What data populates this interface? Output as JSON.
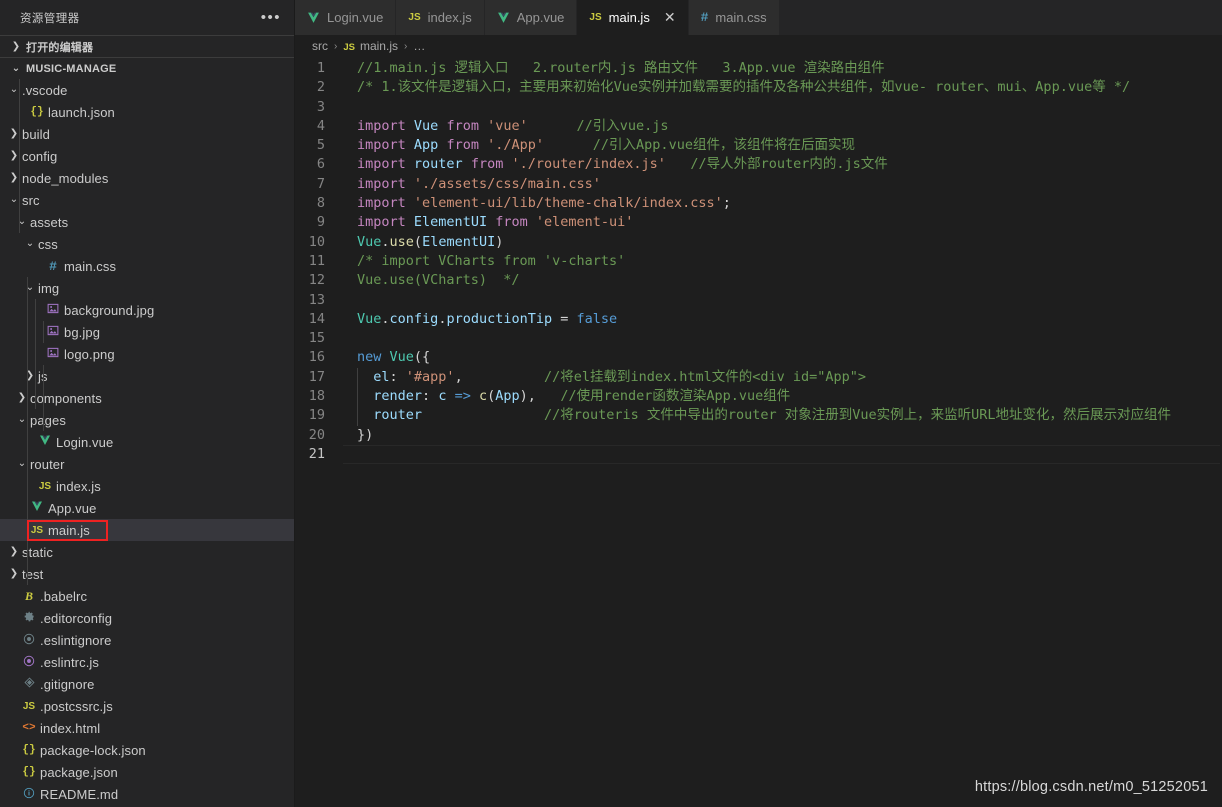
{
  "sidebar": {
    "title": "资源管理器",
    "more_icon": "ellipsis-icon",
    "open_editors_label": "打开的编辑器",
    "project_label": "MUSIC-MANAGE",
    "items": [
      {
        "label": ".vscode",
        "indent": 1,
        "twisty": "chevron-down",
        "icon": "",
        "icon_type": ""
      },
      {
        "label": "launch.json",
        "indent": 2,
        "twisty": "",
        "icon": "{}",
        "icon_type": "json"
      },
      {
        "label": "build",
        "indent": 1,
        "twisty": "chevron-right",
        "icon": "",
        "icon_type": ""
      },
      {
        "label": "config",
        "indent": 1,
        "twisty": "chevron-right",
        "icon": "",
        "icon_type": ""
      },
      {
        "label": "node_modules",
        "indent": 1,
        "twisty": "chevron-right",
        "icon": "",
        "icon_type": ""
      },
      {
        "label": "src",
        "indent": 1,
        "twisty": "chevron-down",
        "icon": "",
        "icon_type": ""
      },
      {
        "label": "assets",
        "indent": 2,
        "twisty": "chevron-down",
        "icon": "",
        "icon_type": ""
      },
      {
        "label": "css",
        "indent": 3,
        "twisty": "chevron-down",
        "icon": "",
        "icon_type": ""
      },
      {
        "label": "main.css",
        "indent": 4,
        "twisty": "",
        "icon": "#",
        "icon_type": "css"
      },
      {
        "label": "img",
        "indent": 3,
        "twisty": "chevron-down",
        "icon": "",
        "icon_type": ""
      },
      {
        "label": "background.jpg",
        "indent": 4,
        "twisty": "",
        "icon": "image",
        "icon_type": "img"
      },
      {
        "label": "bg.jpg",
        "indent": 4,
        "twisty": "",
        "icon": "image",
        "icon_type": "img"
      },
      {
        "label": "logo.png",
        "indent": 4,
        "twisty": "",
        "icon": "image",
        "icon_type": "img"
      },
      {
        "label": "js",
        "indent": 3,
        "twisty": "chevron-right",
        "icon": "",
        "icon_type": ""
      },
      {
        "label": "components",
        "indent": 2,
        "twisty": "chevron-right",
        "icon": "",
        "icon_type": ""
      },
      {
        "label": "pages",
        "indent": 2,
        "twisty": "chevron-down",
        "icon": "",
        "icon_type": ""
      },
      {
        "label": "Login.vue",
        "indent": 3,
        "twisty": "",
        "icon": "V",
        "icon_type": "vue"
      },
      {
        "label": "router",
        "indent": 2,
        "twisty": "chevron-down",
        "icon": "",
        "icon_type": ""
      },
      {
        "label": "index.js",
        "indent": 3,
        "twisty": "",
        "icon": "JS",
        "icon_type": "js"
      },
      {
        "label": "App.vue",
        "indent": 2,
        "twisty": "",
        "icon": "V",
        "icon_type": "vue"
      },
      {
        "label": "main.js",
        "indent": 2,
        "twisty": "",
        "icon": "JS",
        "icon_type": "js",
        "selected": true,
        "highlighted": true
      },
      {
        "label": "static",
        "indent": 1,
        "twisty": "chevron-right",
        "icon": "",
        "icon_type": ""
      },
      {
        "label": "test",
        "indent": 1,
        "twisty": "chevron-right",
        "icon": "",
        "icon_type": ""
      },
      {
        "label": ".babelrc",
        "indent": 1,
        "twisty": "",
        "icon": "B",
        "icon_type": "babel"
      },
      {
        "label": ".editorconfig",
        "indent": 1,
        "twisty": "",
        "icon": "gear",
        "icon_type": "gear"
      },
      {
        "label": ".eslintignore",
        "indent": 1,
        "twisty": "",
        "icon": "circle",
        "icon_type": "eslint1"
      },
      {
        "label": ".eslintrc.js",
        "indent": 1,
        "twisty": "",
        "icon": "circle",
        "icon_type": "eslint2"
      },
      {
        "label": ".gitignore",
        "indent": 1,
        "twisty": "",
        "icon": "diamond",
        "icon_type": "git"
      },
      {
        "label": ".postcssrc.js",
        "indent": 1,
        "twisty": "",
        "icon": "JS",
        "icon_type": "js"
      },
      {
        "label": "index.html",
        "indent": 1,
        "twisty": "",
        "icon": "<>",
        "icon_type": "html"
      },
      {
        "label": "package-lock.json",
        "indent": 1,
        "twisty": "",
        "icon": "{}",
        "icon_type": "json"
      },
      {
        "label": "package.json",
        "indent": 1,
        "twisty": "",
        "icon": "{}",
        "icon_type": "json"
      },
      {
        "label": "README.md",
        "indent": 1,
        "twisty": "",
        "icon": "i",
        "icon_type": "md"
      }
    ]
  },
  "tabs": [
    {
      "label": "Login.vue",
      "icon_type": "vue",
      "icon": "V",
      "active": false,
      "closable": false
    },
    {
      "label": "index.js",
      "icon_type": "js",
      "icon": "JS",
      "active": false,
      "closable": false
    },
    {
      "label": "App.vue",
      "icon_type": "vue",
      "icon": "V",
      "active": false,
      "closable": false
    },
    {
      "label": "main.js",
      "icon_type": "js",
      "icon": "JS",
      "active": true,
      "closable": true,
      "close_icon": "✕"
    },
    {
      "label": "main.css",
      "icon_type": "css",
      "icon": "#",
      "active": false,
      "closable": false
    }
  ],
  "breadcrumb": {
    "items": [
      {
        "label": "src",
        "icon_type": ""
      },
      {
        "label": "main.js",
        "icon_type": "js",
        "icon": "JS"
      },
      {
        "label": "…",
        "icon_type": ""
      }
    ],
    "separator": "›"
  },
  "editor": {
    "line_count": 21,
    "current_line": 21,
    "lines": [
      {
        "n": 1,
        "tokens": [
          {
            "t": "com",
            "v": "//1.main.js 逻辑入口   2.router内.js 路由文件   3.App.vue 渲染路由组件"
          }
        ]
      },
      {
        "n": 2,
        "tokens": [
          {
            "t": "com",
            "v": "/* 1.该文件是逻辑入口，主要用来初始化Vue实例并加载需要的插件及各种公共组件，如vue- router、mui、App.vue等 */"
          }
        ]
      },
      {
        "n": 3,
        "tokens": []
      },
      {
        "n": 4,
        "tokens": [
          {
            "t": "key",
            "v": "import"
          },
          {
            "t": "pln",
            "v": " "
          },
          {
            "t": "var",
            "v": "Vue"
          },
          {
            "t": "pln",
            "v": " "
          },
          {
            "t": "key",
            "v": "from"
          },
          {
            "t": "pln",
            "v": " "
          },
          {
            "t": "str",
            "v": "'vue'"
          },
          {
            "t": "pln",
            "v": "      "
          },
          {
            "t": "com",
            "v": "//引入vue.js"
          }
        ]
      },
      {
        "n": 5,
        "tokens": [
          {
            "t": "key",
            "v": "import"
          },
          {
            "t": "pln",
            "v": " "
          },
          {
            "t": "var",
            "v": "App"
          },
          {
            "t": "pln",
            "v": " "
          },
          {
            "t": "key",
            "v": "from"
          },
          {
            "t": "pln",
            "v": " "
          },
          {
            "t": "str",
            "v": "'./App'"
          },
          {
            "t": "pln",
            "v": "      "
          },
          {
            "t": "com",
            "v": "//引入App.vue组件，该组件将在后面实现"
          }
        ]
      },
      {
        "n": 6,
        "tokens": [
          {
            "t": "key",
            "v": "import"
          },
          {
            "t": "pln",
            "v": " "
          },
          {
            "t": "var",
            "v": "router"
          },
          {
            "t": "pln",
            "v": " "
          },
          {
            "t": "key",
            "v": "from"
          },
          {
            "t": "pln",
            "v": " "
          },
          {
            "t": "str",
            "v": "'./router/index.js'"
          },
          {
            "t": "pln",
            "v": "   "
          },
          {
            "t": "com",
            "v": "//导人外部router内的.js文件"
          }
        ]
      },
      {
        "n": 7,
        "tokens": [
          {
            "t": "key",
            "v": "import"
          },
          {
            "t": "pln",
            "v": " "
          },
          {
            "t": "str",
            "v": "'./assets/css/main.css'"
          }
        ]
      },
      {
        "n": 8,
        "tokens": [
          {
            "t": "key",
            "v": "import"
          },
          {
            "t": "pln",
            "v": " "
          },
          {
            "t": "str",
            "v": "'element-ui/lib/theme-chalk/index.css'"
          },
          {
            "t": "pln",
            "v": ";"
          }
        ]
      },
      {
        "n": 9,
        "tokens": [
          {
            "t": "key",
            "v": "import"
          },
          {
            "t": "pln",
            "v": " "
          },
          {
            "t": "var",
            "v": "ElementUI"
          },
          {
            "t": "pln",
            "v": " "
          },
          {
            "t": "key",
            "v": "from"
          },
          {
            "t": "pln",
            "v": " "
          },
          {
            "t": "str",
            "v": "'element-ui'"
          }
        ]
      },
      {
        "n": 10,
        "tokens": [
          {
            "t": "cls",
            "v": "Vue"
          },
          {
            "t": "pln",
            "v": "."
          },
          {
            "t": "fn2",
            "v": "use"
          },
          {
            "t": "pln",
            "v": "("
          },
          {
            "t": "var",
            "v": "ElementUI"
          },
          {
            "t": "pln",
            "v": ")"
          }
        ]
      },
      {
        "n": 11,
        "tokens": [
          {
            "t": "com",
            "v": "/* import VCharts from 'v-charts'"
          }
        ]
      },
      {
        "n": 12,
        "tokens": [
          {
            "t": "com",
            "v": "Vue.use(VCharts)  */"
          }
        ]
      },
      {
        "n": 13,
        "tokens": []
      },
      {
        "n": 14,
        "tokens": [
          {
            "t": "cls",
            "v": "Vue"
          },
          {
            "t": "pln",
            "v": "."
          },
          {
            "t": "var",
            "v": "config"
          },
          {
            "t": "pln",
            "v": "."
          },
          {
            "t": "var",
            "v": "productionTip"
          },
          {
            "t": "pln",
            "v": " = "
          },
          {
            "t": "key2",
            "v": "false"
          }
        ]
      },
      {
        "n": 15,
        "tokens": []
      },
      {
        "n": 16,
        "tokens": [
          {
            "t": "key2",
            "v": "new"
          },
          {
            "t": "pln",
            "v": " "
          },
          {
            "t": "cls",
            "v": "Vue"
          },
          {
            "t": "pln",
            "v": "({"
          }
        ]
      },
      {
        "n": 17,
        "tokens": [
          {
            "t": "pln",
            "v": "  "
          },
          {
            "t": "var",
            "v": "el"
          },
          {
            "t": "pln",
            "v": ": "
          },
          {
            "t": "str",
            "v": "'#app'"
          },
          {
            "t": "pln",
            "v": ",          "
          },
          {
            "t": "com",
            "v": "//将el挂载到index.html文件的<div id=\"App\">"
          }
        ]
      },
      {
        "n": 18,
        "tokens": [
          {
            "t": "pln",
            "v": "  "
          },
          {
            "t": "var",
            "v": "render"
          },
          {
            "t": "pln",
            "v": ": "
          },
          {
            "t": "var",
            "v": "c"
          },
          {
            "t": "pln",
            "v": " "
          },
          {
            "t": "key2",
            "v": "=>"
          },
          {
            "t": "pln",
            "v": " "
          },
          {
            "t": "fn2",
            "v": "c"
          },
          {
            "t": "pln",
            "v": "("
          },
          {
            "t": "var",
            "v": "App"
          },
          {
            "t": "pln",
            "v": "),   "
          },
          {
            "t": "com",
            "v": "//使用render函数渲染App.vue组件"
          }
        ]
      },
      {
        "n": 19,
        "tokens": [
          {
            "t": "pln",
            "v": "  "
          },
          {
            "t": "var",
            "v": "router"
          },
          {
            "t": "pln",
            "v": "               "
          },
          {
            "t": "com",
            "v": "//将routeris 文件中导出的router 对象注册到Vue实例上，来监听URL地址变化，然后展示对应组件"
          }
        ]
      },
      {
        "n": 20,
        "tokens": [
          {
            "t": "pln",
            "v": "})"
          }
        ]
      },
      {
        "n": 21,
        "tokens": []
      }
    ]
  },
  "watermark": "https://blog.csdn.net/m0_51252051",
  "colors": {
    "sidebar_bg": "#252526",
    "editor_bg": "#1e1e1e",
    "tab_inactive_bg": "#2d2d2d",
    "selected_row": "#37373d",
    "highlight_box": "#ee2222",
    "comment": "#6a9955",
    "keyword": "#c586c0",
    "string": "#ce9178",
    "variable": "#9cdcfe"
  }
}
